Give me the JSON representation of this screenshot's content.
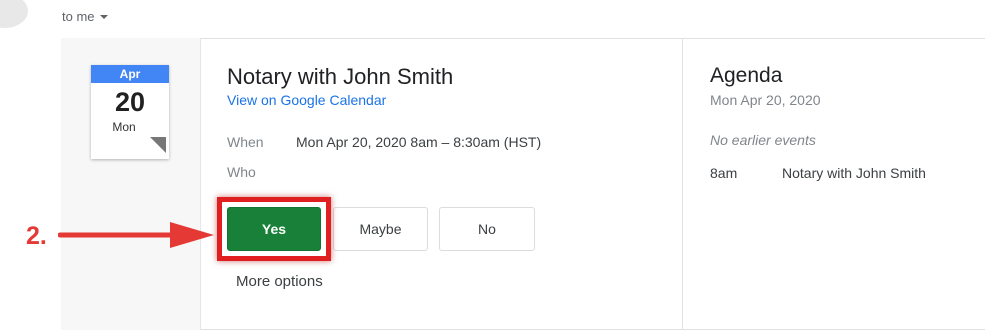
{
  "header": {
    "recipient": "to me"
  },
  "calendar_badge": {
    "month": "Apr",
    "day": "20",
    "weekday": "Mon"
  },
  "event": {
    "title": "Notary with John Smith",
    "calendar_link": "View on Google Calendar",
    "when_label": "When",
    "when_value": "Mon Apr 20, 2020 8am – 8:30am (HST)",
    "who_label": "Who"
  },
  "rsvp": {
    "yes_label": "Yes",
    "maybe_label": "Maybe",
    "no_label": "No",
    "more_options": "More options"
  },
  "annotation": {
    "step_label": "2.",
    "color": "#e53935"
  },
  "agenda": {
    "title": "Agenda",
    "date": "Mon Apr 20, 2020",
    "no_earlier": "No earlier events",
    "items": [
      {
        "time": "8am",
        "title": "Notary with John Smith"
      }
    ]
  },
  "colors": {
    "yes_button": "#188038",
    "link": "#1a73e8",
    "calendar_month": "#4285f4",
    "highlight": "#e02020"
  }
}
